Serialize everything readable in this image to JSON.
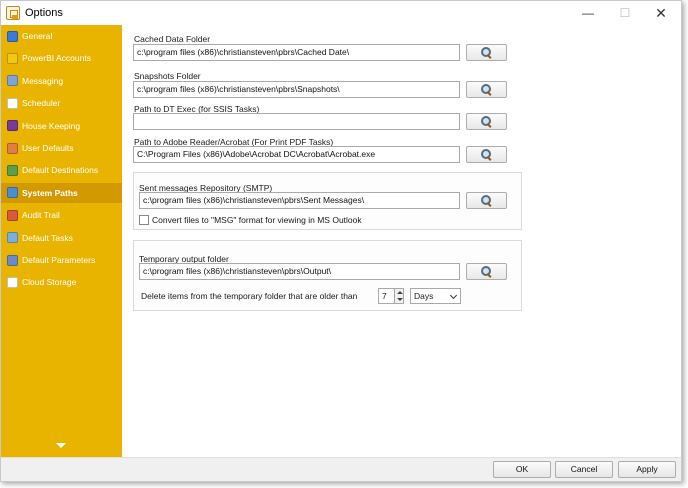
{
  "window": {
    "title": "Options",
    "controls": [
      "minimize",
      "maximize",
      "close"
    ]
  },
  "sidebar": {
    "items": [
      {
        "label": "General",
        "icon": "general-icon",
        "color": "#3a7ad8"
      },
      {
        "label": "PowerBI Accounts",
        "icon": "powerbi-icon",
        "color": "#f2c811"
      },
      {
        "label": "Messaging",
        "icon": "messaging-icon",
        "color": "#7da6d8"
      },
      {
        "label": "Scheduler",
        "icon": "scheduler-icon",
        "color": "#ffffff"
      },
      {
        "label": "House Keeping",
        "icon": "housekeeping-icon",
        "color": "#7a3a9a"
      },
      {
        "label": "User Defaults",
        "icon": "user-defaults-icon",
        "color": "#e08040"
      },
      {
        "label": "Default Destinations",
        "icon": "destinations-icon",
        "color": "#5aa04a"
      },
      {
        "label": "System Paths",
        "icon": "system-paths-icon",
        "color": "#4a90d0",
        "active": true
      },
      {
        "label": "Audit Trail",
        "icon": "audit-trail-icon",
        "color": "#d85a3a"
      },
      {
        "label": "Default Tasks",
        "icon": "default-tasks-icon",
        "color": "#7ab0e0"
      },
      {
        "label": "Default Parameters",
        "icon": "parameters-icon",
        "color": "#6a8ac8"
      },
      {
        "label": "Cloud Storage",
        "icon": "cloud-icon",
        "color": "#ffffff"
      }
    ],
    "active_color": "#d29a00",
    "background": "#e8b400"
  },
  "paths": {
    "cached_label": "Cached Data Folder",
    "cached_value": "c:\\program files (x86)\\christiansteven\\pbrs\\Cached Date\\",
    "snapshots_label": "Snapshots Folder",
    "snapshots_value": "c:\\program files (x86)\\christiansteven\\pbrs\\Snapshots\\",
    "dtexec_label": "Path to DT Exec (for SSIS Tasks)",
    "dtexec_value": "",
    "adobe_label": "Path to Adobe Reader/Acrobat (For Print PDF Tasks)",
    "adobe_value": "C:\\Program Files (x86)\\Adobe\\Acrobat DC\\Acrobat\\Acrobat.exe",
    "sent_label": "Sent messages Repository (SMTP)",
    "sent_value": "c:\\program files (x86)\\christiansteven\\pbrs\\Sent Messages\\",
    "convert_label": "Convert files to \"MSG\" format for viewing in MS Outlook",
    "convert_checked": false,
    "temp_label": "Temporary output folder",
    "temp_value": "c:\\program files (x86)\\christiansteven\\pbrs\\Output\\",
    "delete_label": "Delete items from the temporary folder that are older than",
    "delete_value": "7",
    "delete_unit": "Days"
  },
  "footer": {
    "ok_label": "OK",
    "cancel_label": "Cancel",
    "apply_label": "Apply"
  }
}
